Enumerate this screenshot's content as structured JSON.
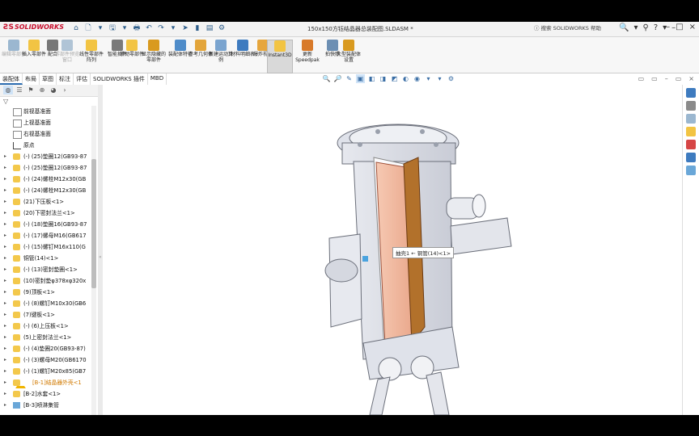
{
  "app": {
    "logo": "SOLIDWORKS",
    "doc_title": "150x150方钰结晶器总装配图.SLDASM *",
    "help_search": "搜索 SOLIDWORKS 帮助"
  },
  "titlebar": {
    "quick_access": [
      "⌂",
      "🗋",
      "▾",
      "🖫",
      "▾",
      "🖶",
      "↶",
      "↷",
      "▾",
      "➤",
      "▮",
      "▤",
      "⚙"
    ],
    "right_icons": [
      "🔍",
      "▾",
      "⚲",
      "?",
      "▾",
      "–"
    ],
    "window_controls": [
      "–",
      "□",
      "×"
    ]
  },
  "commands": [
    {
      "label": "编辑零部件",
      "dim": true,
      "color": "#9bb7d0"
    },
    {
      "label": "插入零部件",
      "dim": false,
      "color": "#f2c443"
    },
    {
      "label": "配合",
      "dim": false,
      "color": "#777777"
    },
    {
      "label": "零部件预览窗口",
      "dim": true,
      "color": "#b0c4d6"
    },
    {
      "label": "线性零部件阵列",
      "dim": false,
      "color": "#f2c443"
    },
    {
      "label": "智能扣件",
      "dim": false,
      "color": "#7a7a7a"
    },
    {
      "label": "移动零部件",
      "dim": false,
      "color": "#f2c443"
    },
    {
      "label": "显示隐藏的零部件",
      "dim": false,
      "color": "#d99a1f"
    },
    {
      "label": "装配体特征",
      "dim": false,
      "color": "#4f8cc9"
    },
    {
      "label": "参考几何体",
      "dim": false,
      "color": "#e3a53a"
    },
    {
      "label": "新建运动算例",
      "dim": false,
      "color": "#7aa4cf"
    },
    {
      "label": "材料明细表",
      "dim": false,
      "color": "#3e7bbf"
    },
    {
      "label": "爆炸视图",
      "dim": false,
      "color": "#e6a63d"
    },
    {
      "label": "Instant3D",
      "dim": false,
      "color": "#f2c443",
      "active": true
    },
    {
      "label": "更新Speedpak",
      "dim": false,
      "color": "#d87a2a"
    },
    {
      "label": "拍快照",
      "dim": false,
      "color": "#6c8fb3"
    },
    {
      "label": "大型装配体设置",
      "dim": false,
      "color": "#d99a1f"
    }
  ],
  "tabs": [
    "装配体",
    "布局",
    "草图",
    "标注",
    "评估",
    "SOLIDWORKS 插件",
    "MBD"
  ],
  "view_tools": [
    "🔍",
    "🔎",
    "✎",
    "▣",
    "◧",
    "◨",
    "◩",
    "◐",
    "◉",
    "▾",
    "▾",
    "⚙"
  ],
  "viewport_controls": [
    "▭",
    "▭",
    "–",
    "▭",
    "×"
  ],
  "panel_tabs": [
    "◍",
    "☰",
    "⚑",
    "⊕",
    "◕",
    "›"
  ],
  "filter_icon": "▽",
  "tree": [
    {
      "type": "plane",
      "label": "前视基准面"
    },
    {
      "type": "plane",
      "label": "上视基准面"
    },
    {
      "type": "plane",
      "label": "右视基准面"
    },
    {
      "type": "origin",
      "label": "原点"
    },
    {
      "type": "part",
      "label": "(-) (25)垫圈12(GB93-87"
    },
    {
      "type": "part",
      "label": "(-) (25)垫圈12(GB93-87"
    },
    {
      "type": "part",
      "label": "(-) (24)螺栓M12x30(GB"
    },
    {
      "type": "part",
      "label": "(-) (24)螺栓M12x30(GB"
    },
    {
      "type": "part",
      "label": "(21)下压板<1>"
    },
    {
      "type": "part",
      "label": "(20)下密封法兰<1>"
    },
    {
      "type": "part",
      "label": "(-) (18)垫圈16(GB93-87"
    },
    {
      "type": "part",
      "label": "(-) (17)螺母M16(GB617"
    },
    {
      "type": "part",
      "label": "(-) (15)螺钉M16x110(G"
    },
    {
      "type": "part",
      "label": "铜管(14)<1>"
    },
    {
      "type": "part",
      "label": "(-) (13)密封垫圈<1>"
    },
    {
      "type": "part",
      "label": "(10)密封垫φ378xφ320x"
    },
    {
      "type": "part",
      "label": "(9)顶板<1>"
    },
    {
      "type": "part",
      "label": "(-) (8)螺钉M10x30(GB6"
    },
    {
      "type": "part",
      "label": "(7)键板<1>"
    },
    {
      "type": "part",
      "label": "(-) (6)上压板<1>"
    },
    {
      "type": "part",
      "label": "(5)上密封法兰<1>"
    },
    {
      "type": "part",
      "label": "(-) (4)垫圈20(GB93-87)"
    },
    {
      "type": "part",
      "label": "(-) (3)螺母M20(GB6170"
    },
    {
      "type": "part",
      "label": "(-) (1)螺钉M20x85(GB7"
    },
    {
      "type": "warn",
      "label": "[B-1]结晶器外壳<1",
      "orange": true
    },
    {
      "type": "part",
      "label": "[B-2]水套<1>"
    },
    {
      "type": "folder",
      "label": "[B-3]喷淋集管"
    }
  ],
  "tooltip": "抽壳1 ← 铜管(14)<1>",
  "taskpane_colors": [
    "#3e7bbf",
    "#8a8a8a",
    "#9bb7d0",
    "#f2c443",
    "#d64545",
    "#3e7bbf",
    "#6aa7d8"
  ]
}
